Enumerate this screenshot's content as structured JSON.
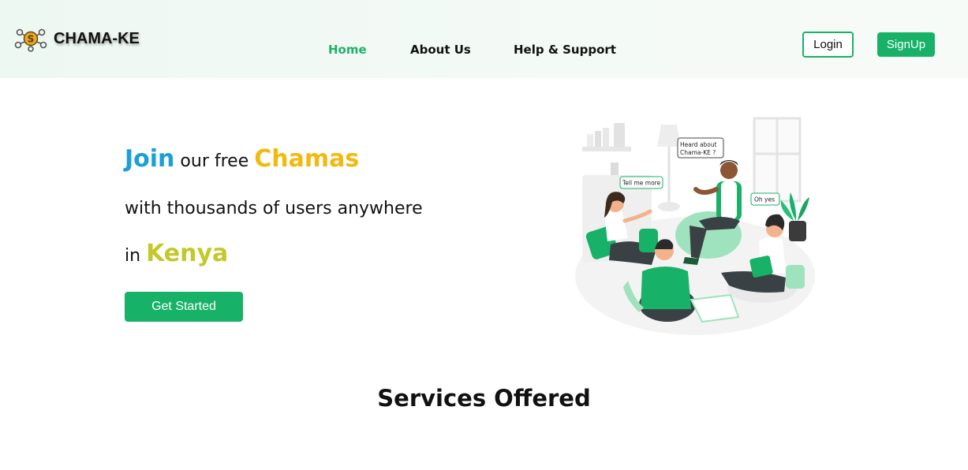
{
  "brand": {
    "name": "CHAMA-KE",
    "logo_icon": "coin-network-logo-icon"
  },
  "nav": {
    "links": [
      {
        "label": "Home",
        "active": true
      },
      {
        "label": "About Us",
        "active": false
      },
      {
        "label": "Help & Support",
        "active": false
      }
    ],
    "login_label": "Login",
    "signup_label": "SignUp"
  },
  "hero": {
    "join": "Join",
    "our_free": "our free",
    "chamas": "Chamas",
    "line2": "with thousands of users anywhere",
    "in": "in",
    "kenya": "Kenya",
    "cta_label": "Get Started"
  },
  "illustration": {
    "bubble_heard": [
      "Heard about",
      "Chama-KE ?"
    ],
    "bubble_tell": "Tell me more",
    "bubble_oh": "Oh yes"
  },
  "services": {
    "title": "Services Offered"
  },
  "colors": {
    "brand_green": "#17b267",
    "join_blue": "#1a9fd6",
    "chamas_yellow": "#f2b90f",
    "kenya_olive": "#c3c92a"
  }
}
